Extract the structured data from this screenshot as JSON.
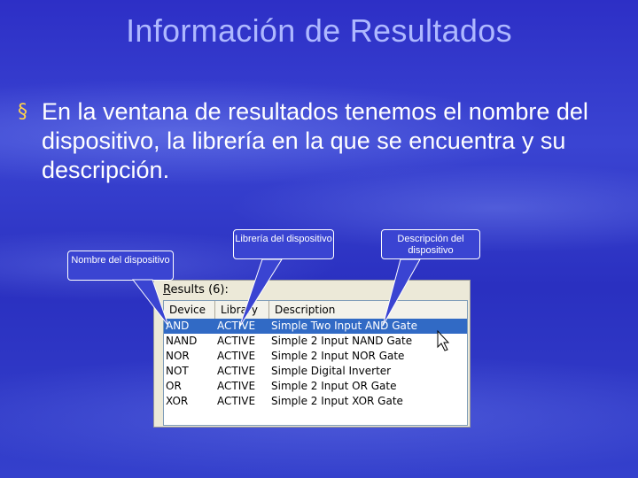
{
  "slide": {
    "title": "Información de Resultados",
    "bullet_marker": "§",
    "bullet_text": "En la ventana de resultados tenemos el nombre del dispositivo, la librería en la que se encuentra y su descripción."
  },
  "callouts": {
    "device_name": "Nombre del dispositivo",
    "library": "Librería del dispositivo",
    "description": "Descripción del dispositivo"
  },
  "results_panel": {
    "label_prefix": "R",
    "label_rest": "esults (6):",
    "columns": [
      "Device",
      "Library",
      "Description"
    ],
    "rows": [
      {
        "device": "AND",
        "library": "ACTIVE",
        "description": "Simple Two Input AND Gate",
        "selected": true
      },
      {
        "device": "NAND",
        "library": "ACTIVE",
        "description": "Simple 2 Input NAND Gate"
      },
      {
        "device": "NOR",
        "library": "ACTIVE",
        "description": "Simple 2 Input NOR Gate"
      },
      {
        "device": "NOT",
        "library": "ACTIVE",
        "description": "Simple Digital Inverter"
      },
      {
        "device": "OR",
        "library": "ACTIVE",
        "description": "Simple 2 Input OR Gate"
      },
      {
        "device": "XOR",
        "library": "ACTIVE",
        "description": "Simple 2 Input XOR Gate"
      }
    ]
  },
  "colors": {
    "background": "#2d2fc6",
    "title": "#aeb8ff",
    "bullet": "#ffd24a",
    "selection": "#316ac5"
  },
  "icons": [
    "arrow-cursor-icon"
  ]
}
